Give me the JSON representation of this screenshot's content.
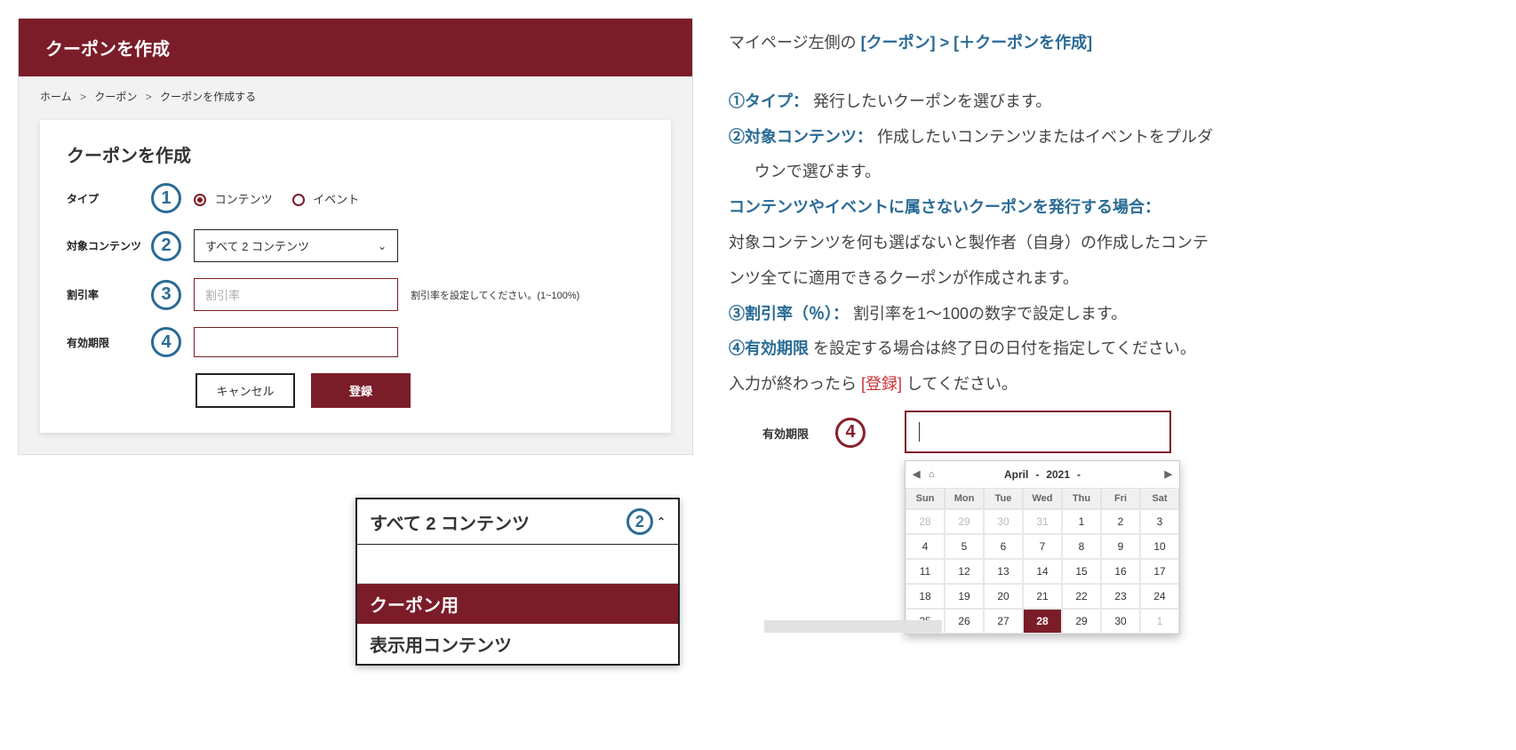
{
  "header": {
    "title": "クーポンを作成"
  },
  "breadcrumb": {
    "home": "ホーム",
    "coupon": "クーポン",
    "create": "クーポンを作成する",
    "sep": ">"
  },
  "card": {
    "title": "クーポンを作成"
  },
  "badges": {
    "one": "1",
    "two": "2",
    "three": "3",
    "four": "4"
  },
  "form": {
    "type_label": "タイプ",
    "type_options": {
      "contents": "コンテンツ",
      "event": "イベント"
    },
    "target_label": "対象コンテンツ",
    "target_selected": "すべて 2 コンテンツ",
    "discount_label": "割引率",
    "discount_placeholder": "割引率",
    "discount_hint": "割引率を設定してください。(1~100%)",
    "expiry_label": "有効期限"
  },
  "buttons": {
    "cancel": "キャンセル",
    "submit": "登録"
  },
  "dropdown": {
    "head": "すべて 2 コンテンツ",
    "item_selected": "クーポン用",
    "item2": "表示用コンテンツ"
  },
  "instructions": {
    "line1_a": "マイページ左側の ",
    "nav_coupon": "[クーポン]",
    "nav_sep": " > ",
    "nav_create": "[＋クーポンを作成]",
    "type_label": "①タイプ：",
    "type_text": "発行したいクーポンを選びます。",
    "target_label": "②対象コンテンツ：",
    "target_text1": "作成したいコンテンツまたはイベントをプルダ",
    "target_text2": "ウンで選びます。",
    "special_head": "コンテンツやイベントに属さないクーポンを発行する場合：",
    "special_text1": "対象コンテンツを何も選ばないと製作者（自身）の作成したコンテ",
    "special_text2": "ンツ全てに適用できるクーポンが作成されます。",
    "discount_label": "③割引率（％）：",
    "discount_text": "割引率を1〜100の数字で設定します。",
    "expiry_label": "④有効期限",
    "expiry_text": "を設定する場合は終了日の日付を指定してください。",
    "final_a": "入力が終わったら",
    "final_red": "[登録]",
    "final_b": "してください。"
  },
  "date": {
    "label": "有効期限"
  },
  "calendar": {
    "month": "April",
    "year": "2021",
    "dow": [
      "Sun",
      "Mon",
      "Tue",
      "Wed",
      "Thu",
      "Fri",
      "Sat"
    ],
    "grid": [
      [
        {
          "d": "28",
          "m": true
        },
        {
          "d": "29",
          "m": true
        },
        {
          "d": "30",
          "m": true
        },
        {
          "d": "31",
          "m": true
        },
        {
          "d": "1"
        },
        {
          "d": "2"
        },
        {
          "d": "3"
        }
      ],
      [
        {
          "d": "4"
        },
        {
          "d": "5"
        },
        {
          "d": "6"
        },
        {
          "d": "7"
        },
        {
          "d": "8"
        },
        {
          "d": "9"
        },
        {
          "d": "10"
        }
      ],
      [
        {
          "d": "11"
        },
        {
          "d": "12"
        },
        {
          "d": "13"
        },
        {
          "d": "14"
        },
        {
          "d": "15"
        },
        {
          "d": "16"
        },
        {
          "d": "17"
        }
      ],
      [
        {
          "d": "18"
        },
        {
          "d": "19"
        },
        {
          "d": "20"
        },
        {
          "d": "21"
        },
        {
          "d": "22"
        },
        {
          "d": "23"
        },
        {
          "d": "24"
        }
      ],
      [
        {
          "d": "25"
        },
        {
          "d": "26"
        },
        {
          "d": "27"
        },
        {
          "d": "28",
          "sel": true
        },
        {
          "d": "29"
        },
        {
          "d": "30"
        },
        {
          "d": "1",
          "m": true
        }
      ]
    ]
  }
}
